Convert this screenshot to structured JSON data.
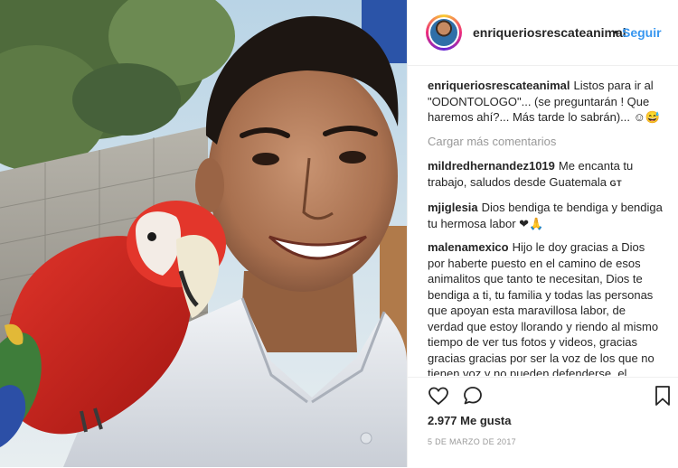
{
  "post": {
    "username": "enriqueriosrescateanimal",
    "follow_label": "Seguir",
    "dot": "•",
    "caption": "Listos para ir al \"ODONTOLOGO\"... (se preguntarán ! Que haremos ahí?... Más tarde lo sabrán)... ☺😅",
    "load_more": "Cargar más comentarios",
    "likes": "2.977 Me gusta",
    "date": "5 DE MARZO DE 2017"
  },
  "comments": [
    {
      "user": "mildredhernandez1019",
      "text": "Me encanta tu trabajo, saludos desde Guatemala",
      "flag": "GT"
    },
    {
      "user": "mjiglesia",
      "text": "Dios bendiga te bendiga y bendiga tu hermosa labor ❤🙏"
    },
    {
      "user": "malenamexico",
      "text": "Hijo le doy gracias a Dios por haberte puesto en el camino de esos animalitos que tanto te necesitan, Dios te bendiga a ti, tu familia y todas las personas que apoyan esta maravillosa labor, de verdad que estoy llorando y riendo al mismo tiempo de ver tus fotos y videos, gracias gracias gracias por ser la voz de los que no tienen voz y no pueden defenderse, el mundo seria distinto si hubiera más"
    }
  ],
  "icons": {
    "like": "heart-icon",
    "comment": "comment-bubble-icon",
    "save": "bookmark-icon"
  },
  "colors": {
    "accent": "#3897f0",
    "muted": "#999999",
    "text": "#262626"
  }
}
